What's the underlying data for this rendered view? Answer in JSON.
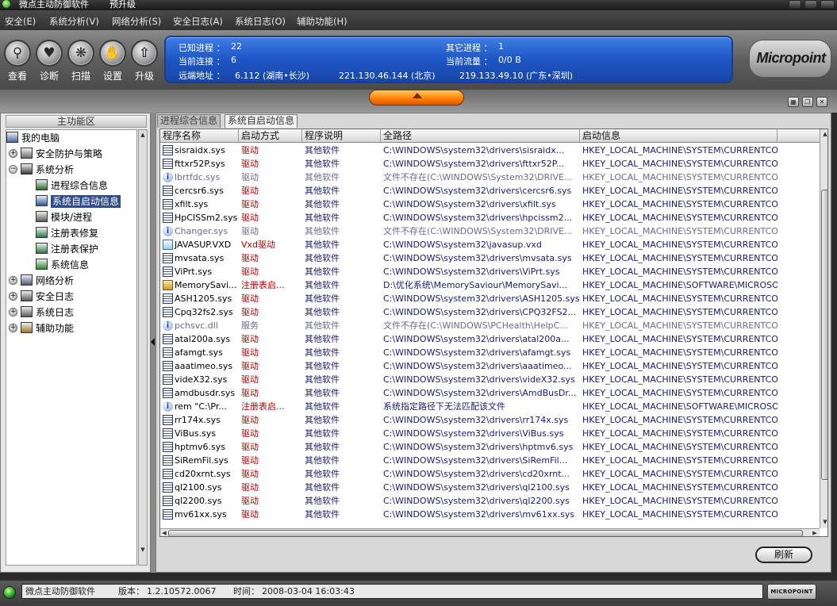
{
  "window": {
    "title": "微点主动防御软件",
    "subtitle": "预升级"
  },
  "menu": [
    "安全(E)",
    "系统分析(V)",
    "网络分析(S)",
    "安全日志(A)",
    "系统日志(O)",
    "辅助功能(H)"
  ],
  "toolbar": {
    "buttons": [
      {
        "label": "查看",
        "icon": "search-icon"
      },
      {
        "label": "诊断",
        "icon": "heart-icon"
      },
      {
        "label": "扫描",
        "icon": "scan-icon"
      },
      {
        "label": "设置",
        "icon": "hand-icon"
      },
      {
        "label": "升级",
        "icon": "upgrade-arrow-icon"
      }
    ]
  },
  "info": {
    "known_process_label": "已知进程 ：",
    "known_process_value": "22",
    "other_process_label": "其它进程 ：",
    "other_process_value": "1",
    "connections_label": "当前连接 ：",
    "connections_value": "6",
    "traffic_label": "当前流量 ：",
    "traffic_value": "0/0 B",
    "remote_label": "远端地址 ：",
    "remote_1": "6.112 (湖南•长沙)",
    "remote_2": "221.130.46.144 (北京)",
    "remote_3": "219.133.49.10 (广东•深圳)"
  },
  "brand": {
    "logo_text": "Micropoint",
    "status_logo_text": "MICROPOINT"
  },
  "left": {
    "header": "主功能区",
    "tree": [
      {
        "label": "我的电脑",
        "level": 0,
        "expander": "",
        "icon": "computer-icon"
      },
      {
        "label": "安全防护与策略",
        "level": 1,
        "expander": "+",
        "icon": "shield-flag-icon"
      },
      {
        "label": "系统分析",
        "level": 1,
        "expander": "−",
        "icon": "monitor-icon"
      },
      {
        "label": "进程综合信息",
        "level": 2,
        "expander": "",
        "icon": "process-info-icon"
      },
      {
        "label": "系统自启动信息",
        "level": 2,
        "expander": "",
        "icon": "autostart-icon",
        "selected": true
      },
      {
        "label": "模块/进程",
        "level": 2,
        "expander": "",
        "icon": "module-icon"
      },
      {
        "label": "注册表修复",
        "level": 2,
        "expander": "",
        "icon": "registry-repair-icon"
      },
      {
        "label": "注册表保护",
        "level": 2,
        "expander": "",
        "icon": "registry-protect-icon"
      },
      {
        "label": "系统信息",
        "level": 2,
        "expander": "",
        "icon": "system-info-icon"
      },
      {
        "label": "网络分析",
        "level": 1,
        "expander": "+",
        "icon": "network-icon"
      },
      {
        "label": "安全日志",
        "level": 1,
        "expander": "+",
        "icon": "security-log-icon"
      },
      {
        "label": "系统日志",
        "level": 1,
        "expander": "+",
        "icon": "system-log-icon"
      },
      {
        "label": "辅助功能",
        "level": 1,
        "expander": "+",
        "icon": "tools-icon"
      }
    ]
  },
  "tabs": [
    {
      "label": "进程综合信息",
      "active": false
    },
    {
      "label": "系统自启动信息",
      "active": true
    }
  ],
  "table": {
    "columns": [
      "程序名称",
      "启动方式",
      "程序说明",
      "全路径",
      "启动信息"
    ],
    "rows": [
      {
        "name": "sisraidx.sys",
        "start": "驱动",
        "desc": "其他软件",
        "path": "C:\\WINDOWS\\system32\\drivers\\sisraidx...",
        "boot": "HKEY_LOCAL_MACHINE\\SYSTEM\\CURRENTCON...",
        "icon": "driver"
      },
      {
        "name": "fttxr52P.sys",
        "start": "驱动",
        "desc": "其他软件",
        "path": "C:\\WINDOWS\\system32\\drivers\\fttxr52P...",
        "boot": "HKEY_LOCAL_MACHINE\\SYSTEM\\CURRENTCON...",
        "icon": "driver"
      },
      {
        "name": "lbrtfdc.sys",
        "start": "驱动",
        "desc": "其他软件",
        "path": "文件不存在(C:\\WINDOWS\\System32\\DRIVE...",
        "boot": "HKEY_LOCAL_MACHINE\\SYSTEM\\CURRENTCON...",
        "icon": "info",
        "dim": true
      },
      {
        "name": "cercsr6.sys",
        "start": "驱动",
        "desc": "其他软件",
        "path": "C:\\WINDOWS\\system32\\drivers\\cercsr6.sys",
        "boot": "HKEY_LOCAL_MACHINE\\SYSTEM\\CURRENTCON...",
        "icon": "driver"
      },
      {
        "name": "xfilt.sys",
        "start": "驱动",
        "desc": "其他软件",
        "path": "C:\\WINDOWS\\system32\\drivers\\xfilt.sys",
        "boot": "HKEY_LOCAL_MACHINE\\SYSTEM\\CURRENTCON...",
        "icon": "driver"
      },
      {
        "name": "HpCISSm2.sys",
        "start": "驱动",
        "desc": "其他软件",
        "path": "C:\\WINDOWS\\system32\\drivers\\hpcissm2...",
        "boot": "HKEY_LOCAL_MACHINE\\SYSTEM\\CURRENTCON...",
        "icon": "driver"
      },
      {
        "name": "Changer.sys",
        "start": "驱动",
        "desc": "其他软件",
        "path": "文件不存在(C:\\WINDOWS\\System32\\DRIVE...",
        "boot": "HKEY_LOCAL_MACHINE\\SYSTEM\\CURRENTCON...",
        "icon": "info",
        "dim": true
      },
      {
        "name": "JAVASUP.VXD",
        "start": "Vxd驱动",
        "desc": "其他软件",
        "path": "C:\\WINDOWS\\system32\\javasup.vxd",
        "boot": "HKEY_LOCAL_MACHINE\\SYSTEM\\CURRENTCON...",
        "icon": "vxd"
      },
      {
        "name": "mvsata.sys",
        "start": "驱动",
        "desc": "其他软件",
        "path": "C:\\WINDOWS\\system32\\drivers\\mvsata.sys",
        "boot": "HKEY_LOCAL_MACHINE\\SYSTEM\\CURRENTCON...",
        "icon": "driver"
      },
      {
        "name": "ViPrt.sys",
        "start": "驱动",
        "desc": "其他软件",
        "path": "C:\\WINDOWS\\system32\\drivers\\ViPrt.sys",
        "boot": "HKEY_LOCAL_MACHINE\\SYSTEM\\CURRENTCON...",
        "icon": "driver"
      },
      {
        "name": "MemorySavi...",
        "start": "注册表启...",
        "desc": "其他软件",
        "path": "D:\\优化系统\\MemorySaviour\\MemorySavi...",
        "boot": "HKEY_LOCAL_MACHINE\\SOFTWARE\\MICROSOF...",
        "icon": "registry"
      },
      {
        "name": "ASH1205.sys",
        "start": "驱动",
        "desc": "其他软件",
        "path": "C:\\WINDOWS\\system32\\drivers\\ASH1205.sys",
        "boot": "HKEY_LOCAL_MACHINE\\SYSTEM\\CURRENTCON...",
        "icon": "driver"
      },
      {
        "name": "Cpq32fs2.sys",
        "start": "驱动",
        "desc": "其他软件",
        "path": "C:\\WINDOWS\\system32\\drivers\\CPQ32FS2...",
        "boot": "HKEY_LOCAL_MACHINE\\SYSTEM\\CURRENTCON...",
        "icon": "driver"
      },
      {
        "name": "pchsvc.dll",
        "start": "服务",
        "desc": "其他软件",
        "path": "文件不存在(C:\\WINDOWS\\PCHealth\\HelpC...",
        "boot": "HKEY_LOCAL_MACHINE\\SYSTEM\\CURRENTCON...",
        "icon": "info",
        "dim": true
      },
      {
        "name": "atal200a.sys",
        "start": "驱动",
        "desc": "其他软件",
        "path": "C:\\WINDOWS\\system32\\drivers\\atal200a...",
        "boot": "HKEY_LOCAL_MACHINE\\SYSTEM\\CURRENTCON...",
        "icon": "driver"
      },
      {
        "name": "afamgt.sys",
        "start": "驱动",
        "desc": "其他软件",
        "path": "C:\\WINDOWS\\system32\\drivers\\afamgt.sys",
        "boot": "HKEY_LOCAL_MACHINE\\SYSTEM\\CURRENTCON...",
        "icon": "driver"
      },
      {
        "name": "aaatimeo.sys",
        "start": "驱动",
        "desc": "其他软件",
        "path": "C:\\WINDOWS\\system32\\drivers\\aaatimeo...",
        "boot": "HKEY_LOCAL_MACHINE\\SYSTEM\\CURRENTCON...",
        "icon": "driver"
      },
      {
        "name": "videX32.sys",
        "start": "驱动",
        "desc": "其他软件",
        "path": "C:\\WINDOWS\\system32\\drivers\\videX32.sys",
        "boot": "HKEY_LOCAL_MACHINE\\SYSTEM\\CURRENTCON...",
        "icon": "driver"
      },
      {
        "name": "amdbusdr.sys",
        "start": "驱动",
        "desc": "其他软件",
        "path": "C:\\WINDOWS\\system32\\drivers\\AmdBusDr...",
        "boot": "HKEY_LOCAL_MACHINE\\SYSTEM\\CURRENTCON...",
        "icon": "driver"
      },
      {
        "name": "rem \"C:\\Pr...",
        "start": "注册表启...",
        "desc": "其他软件",
        "path": "系统指定路径下无法匹配该文件",
        "boot": "HKEY_LOCAL_MACHINE\\SOFTWARE\\MICROSOF...",
        "icon": "info"
      },
      {
        "name": "rr174x.sys",
        "start": "驱动",
        "desc": "其他软件",
        "path": "C:\\WINDOWS\\system32\\drivers\\rr174x.sys",
        "boot": "HKEY_LOCAL_MACHINE\\SYSTEM\\CURRENTCON...",
        "icon": "driver"
      },
      {
        "name": "ViBus.sys",
        "start": "驱动",
        "desc": "其他软件",
        "path": "C:\\WINDOWS\\system32\\drivers\\ViBus.sys",
        "boot": "HKEY_LOCAL_MACHINE\\SYSTEM\\CURRENTCON...",
        "icon": "driver"
      },
      {
        "name": "hptmv6.sys",
        "start": "驱动",
        "desc": "其他软件",
        "path": "C:\\WINDOWS\\system32\\drivers\\hptmv6.sys",
        "boot": "HKEY_LOCAL_MACHINE\\SYSTEM\\CURRENTCON...",
        "icon": "driver"
      },
      {
        "name": "SiRemFil.sys",
        "start": "驱动",
        "desc": "其他软件",
        "path": "C:\\WINDOWS\\system32\\drivers\\SiRemFil...",
        "boot": "HKEY_LOCAL_MACHINE\\SYSTEM\\CURRENTCON...",
        "icon": "driver"
      },
      {
        "name": "cd20xrnt.sys",
        "start": "驱动",
        "desc": "其他软件",
        "path": "C:\\WINDOWS\\system32\\drivers\\cd20xrnt...",
        "boot": "HKEY_LOCAL_MACHINE\\SYSTEM\\CURRENTCON...",
        "icon": "driver"
      },
      {
        "name": "ql2100.sys",
        "start": "驱动",
        "desc": "其他软件",
        "path": "C:\\WINDOWS\\system32\\drivers\\ql2100.sys",
        "boot": "HKEY_LOCAL_MACHINE\\SYSTEM\\CURRENTCON...",
        "icon": "driver"
      },
      {
        "name": "ql2200.sys",
        "start": "驱动",
        "desc": "其他软件",
        "path": "C:\\WINDOWS\\system32\\drivers\\ql2200.sys",
        "boot": "HKEY_LOCAL_MACHINE\\SYSTEM\\CURRENTCON...",
        "icon": "driver"
      },
      {
        "name": "mv61xx.sys",
        "start": "驱动",
        "desc": "其他软件",
        "path": "C:\\WINDOWS\\system32\\drivers\\mv61xx.sys",
        "boot": "HKEY_LOCAL_MACHINE\\SYSTEM\\CURRENTCON...",
        "icon": "driver"
      }
    ]
  },
  "refresh_label": "刷新",
  "status": {
    "app": "微点主动防御软件",
    "version_label": "版本：",
    "version": "1.2.10572.0067",
    "time_label": "时间：",
    "time": "2008-03-04 16:03:43"
  }
}
